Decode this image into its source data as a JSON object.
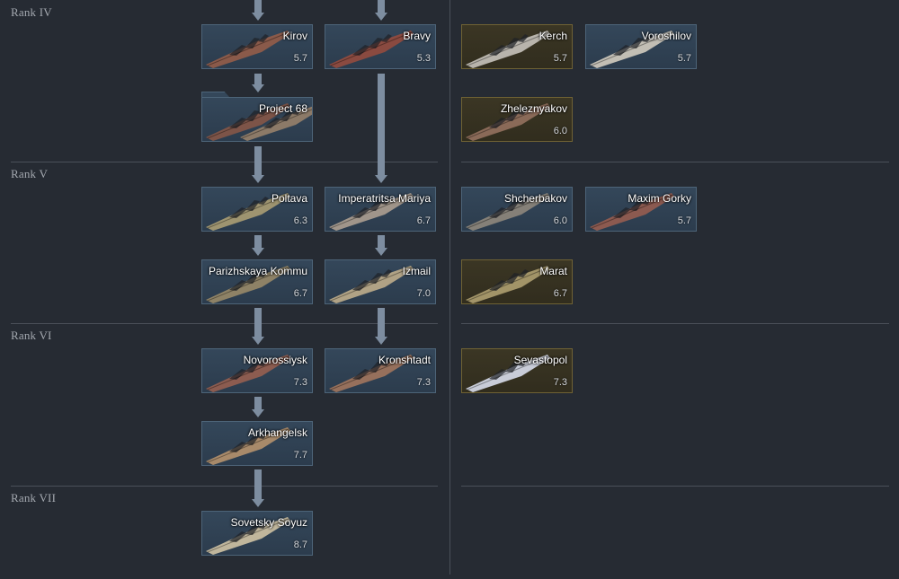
{
  "ranks": {
    "r4": "Rank IV",
    "r5": "Rank V",
    "r6": "Rank VI",
    "r7": "Rank VII"
  },
  "colors": {
    "background": "#262b33",
    "card_border": "#4d6478",
    "premium_border": "#6f6234",
    "arrow": "#7d8da0"
  },
  "tree": {
    "kirov": {
      "name": "Kirov",
      "br": "5.7"
    },
    "bravy": {
      "name": "Bravy",
      "br": "5.3"
    },
    "project68": {
      "name": "Project 68",
      "br": ""
    },
    "poltava": {
      "name": "Poltava",
      "br": "6.3"
    },
    "imperatritsa": {
      "name": "Imperatritsa Mariya",
      "br": "6.7"
    },
    "parizhskaya": {
      "name": "Parizhskaya Kommu",
      "br": "6.7"
    },
    "izmail": {
      "name": "Izmail",
      "br": "7.0"
    },
    "novorossiysk": {
      "name": "Novorossiysk",
      "br": "7.3"
    },
    "kronshtadt": {
      "name": "Kronshtadt",
      "br": "7.3"
    },
    "arkhangelsk": {
      "name": "Arkhangelsk",
      "br": "7.7"
    },
    "sovetsky": {
      "name": "Sovetsky Soyuz",
      "br": "8.7"
    }
  },
  "premium": {
    "kerch": {
      "name": "Kerch",
      "br": "5.7"
    },
    "voroshilov": {
      "name": "Voroshilov",
      "br": "5.7"
    },
    "zheleznyakov": {
      "name": "Zheleznyakov",
      "br": "6.0"
    },
    "shcherbakov": {
      "name": "Shcherbakov",
      "br": "6.0"
    },
    "maxim_gorky": {
      "name": "Maxim Gorky",
      "br": "5.7"
    },
    "marat": {
      "name": "Marat",
      "br": "6.7"
    },
    "sevastopol": {
      "name": "Sevastopol",
      "br": "7.3"
    }
  }
}
